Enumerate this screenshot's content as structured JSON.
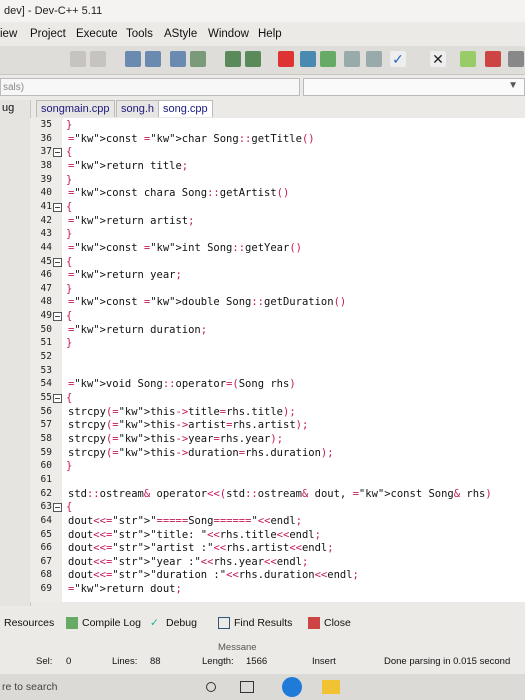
{
  "window": {
    "title": "dev] - Dev-C++ 5.11"
  },
  "menu": [
    "iew",
    "Project",
    "Execute",
    "Tools",
    "AStyle",
    "Window",
    "Help"
  ],
  "combo": {
    "left_text": "sals)"
  },
  "left_pane": {
    "label": "ug"
  },
  "tabs": [
    "songmain.cpp",
    "song.h",
    "song.cpp"
  ],
  "line_numbers": [
    "35",
    "36",
    "37",
    "38",
    "39",
    "40",
    "41",
    "42",
    "43",
    "44",
    "45",
    "46",
    "47",
    "48",
    "49",
    "50",
    "51",
    "52",
    "53",
    "54",
    "55",
    "56",
    "57",
    "58",
    "59",
    "60",
    "61",
    "62",
    "63",
    "64",
    "65",
    "66",
    "67",
    "68",
    "69"
  ],
  "code_lines": [
    "}",
    "const char Song::getTitle()",
    "{",
    "return title;",
    "}",
    "const chara Song::getArtist()",
    "{",
    "return artist;",
    "}",
    "const int Song::getYear()",
    "{",
    "return year;",
    "}",
    "const double Song::getDuration()",
    "{",
    "return duration;",
    "}",
    "",
    "",
    "void Song::operator=(Song rhs)",
    "{",
    "strcpy(this->title=rhs.title);",
    "strcpy(this->artist=rhs.artist);",
    "strcpy(this->year=rhs.year);",
    "strcpy(this->duration=rhs.duration);",
    "}",
    "",
    "std::ostream& operator<<(std::ostream& dout, const Song& rhs)",
    "{",
    "dout<<\"=====Song======\"<<endl;",
    "dout<<\"title: \"<<rhs.title<<endl;",
    "dout<<\"artist :\"<<rhs.artist<<endl;",
    "dout<<\"year :\"<<rhs.year<<endl;",
    "dout<<\"duration :\"<<rhs.duration<<endl;",
    "return dout;"
  ],
  "bottom_tabs": {
    "resources": "Resources",
    "compile_log": "Compile Log",
    "debug": "Debug",
    "find_results": "Find Results",
    "close": "Close"
  },
  "status": {
    "message": "Messane",
    "sel_label": "Sel:",
    "sel_value": "0",
    "lines_label": "Lines:",
    "lines_value": "88",
    "length_label": "Length:",
    "length_value": "1566",
    "mode": "Insert",
    "parse": "Done parsing in 0.015 second"
  },
  "taskbar": {
    "search": "re to search"
  },
  "colors": {
    "keyword": "#111111",
    "operator": "#c2185b",
    "string": "#1a1a90"
  }
}
